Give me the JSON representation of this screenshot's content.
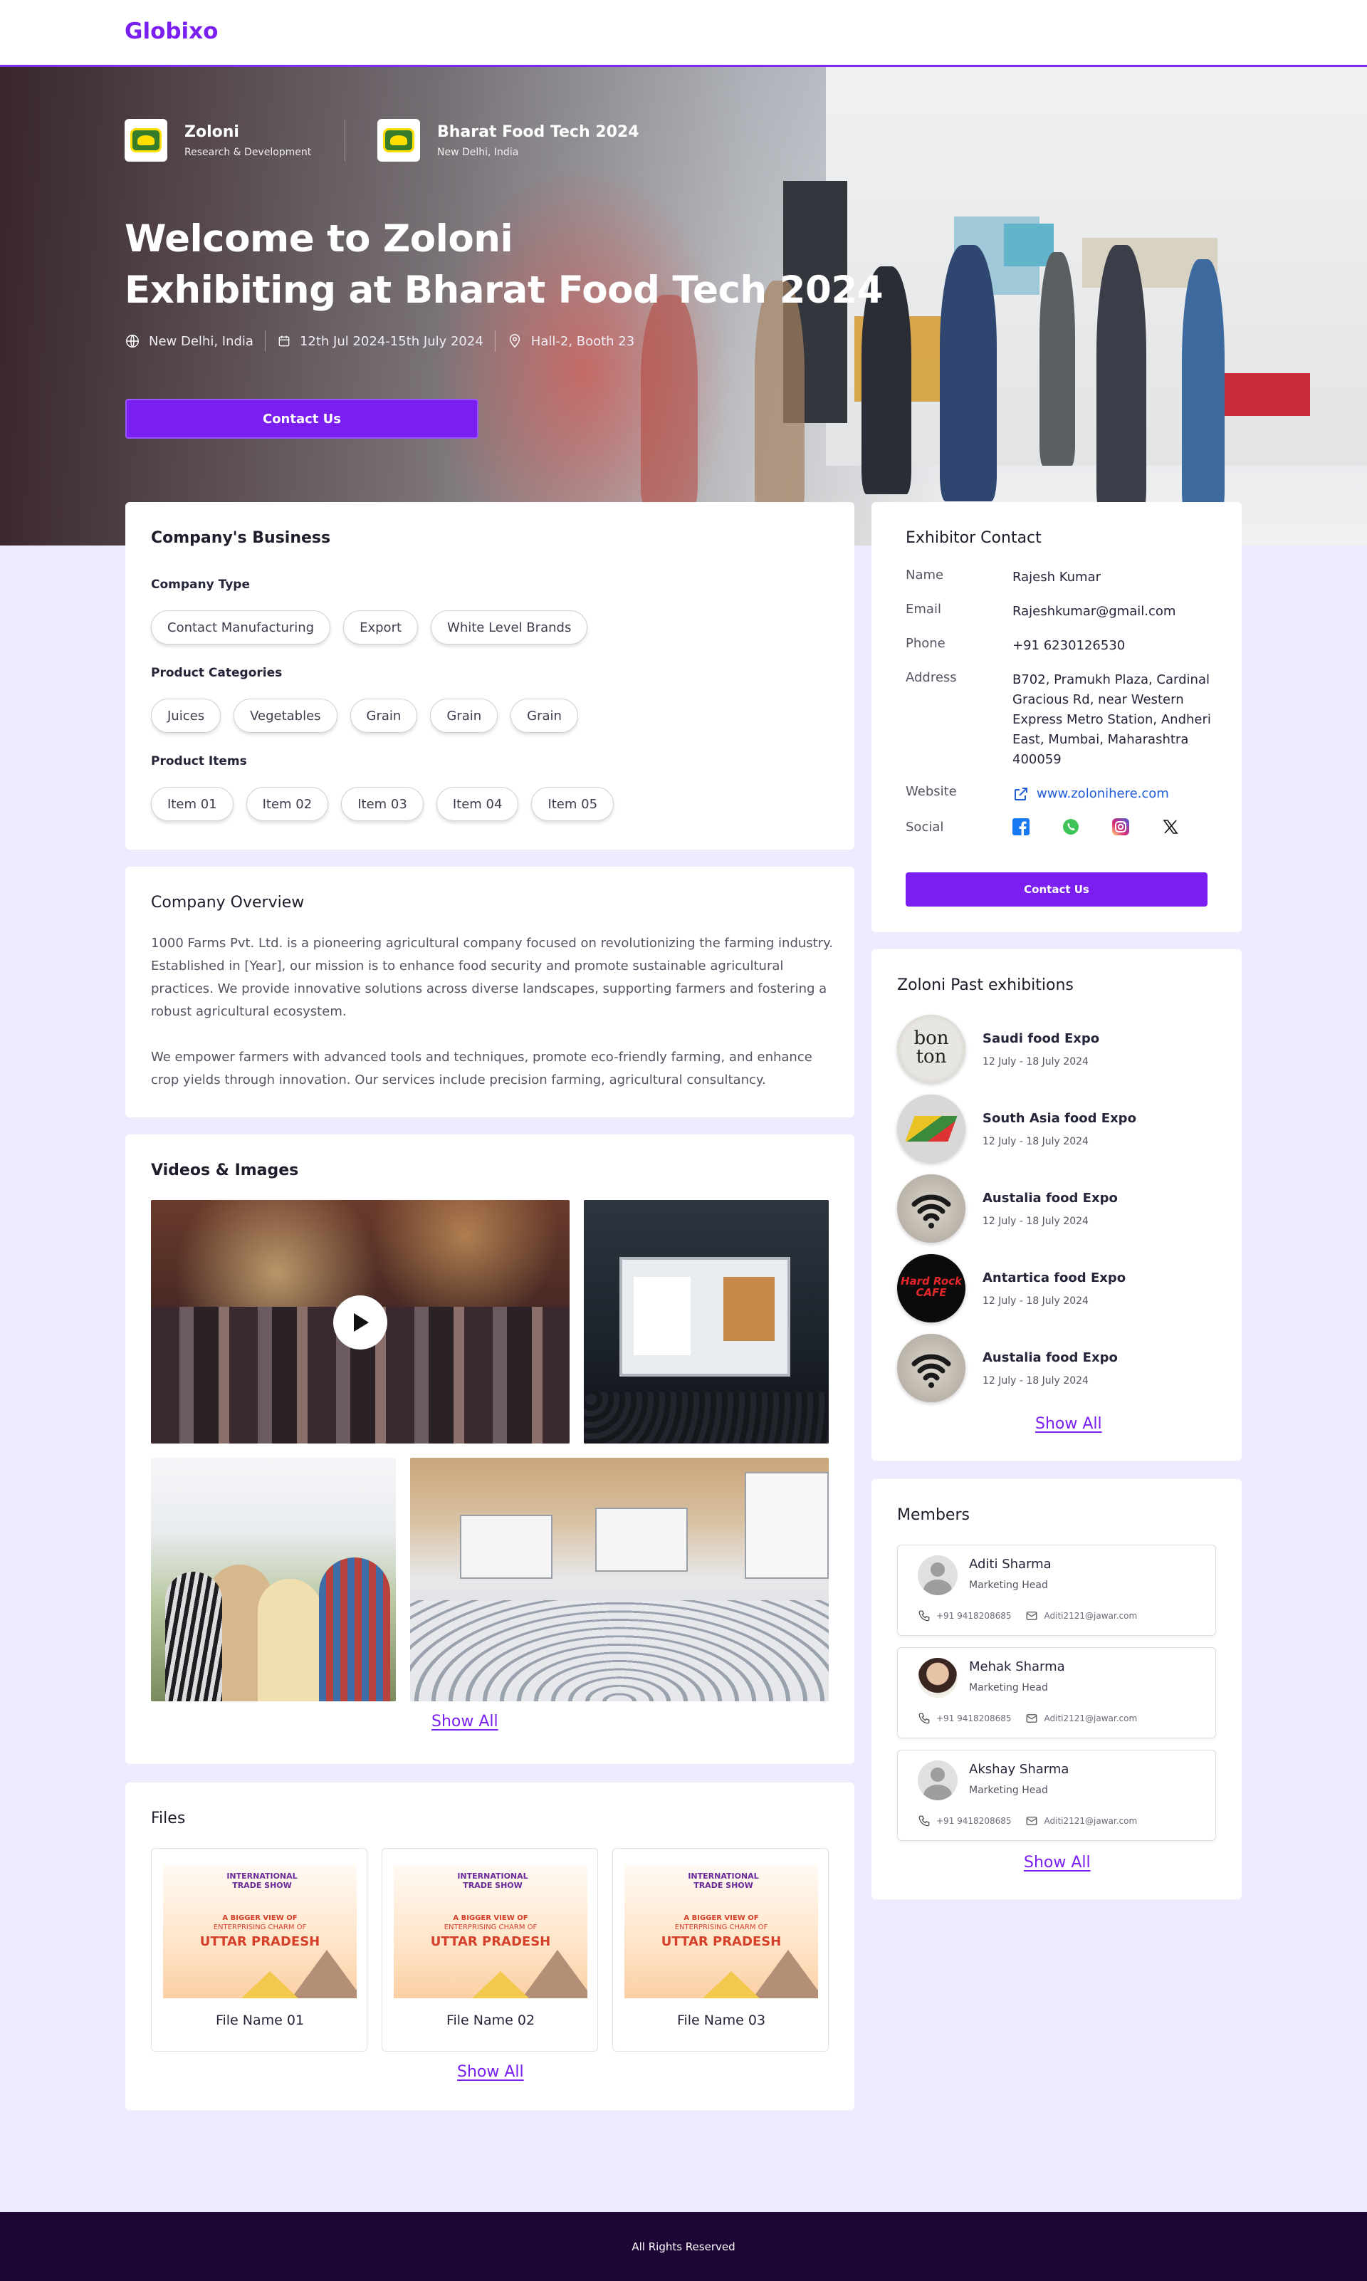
{
  "brand": {
    "name": "Globixo"
  },
  "hero": {
    "company": {
      "name": "Zoloni",
      "sub": "Research & Development"
    },
    "event": {
      "name": "Bharat Food Tech  2024",
      "sub": "New Delhi, India"
    },
    "title_line1": "Welcome to Zoloni",
    "title_line2": "Exhibiting at Bharat Food Tech  2024",
    "location": "New Delhi, India",
    "dates": "12th Jul 2024-15th July 2024",
    "booth": "Hall-2, Booth 23",
    "cta": "Contact Us"
  },
  "business": {
    "title": "Company's Business",
    "company_type_label": "Company Type",
    "company_types": [
      "Contact Manufacturing",
      "Export",
      "White Level Brands"
    ],
    "product_categories_label": "Product Categories",
    "product_categories": [
      "Juices",
      "Vegetables",
      "Grain",
      "Grain",
      "Grain"
    ],
    "product_items_label": "Product Items",
    "product_items": [
      "Item 01",
      "Item 02",
      "Item 03",
      "Item 04",
      "Item 05"
    ]
  },
  "overview": {
    "title": "Company Overview",
    "p1": "1000 Farms Pvt. Ltd. is a pioneering agricultural company focused on revolutionizing the farming industry. Established in [Year], our mission is to enhance food security and promote sustainable agricultural practices. We provide innovative solutions across diverse landscapes, supporting farmers and fostering a robust agricultural ecosystem.",
    "p2": "We empower farmers with advanced tools and techniques, promote eco-friendly farming, and enhance crop yields through innovation. Our services include precision farming, agricultural consultancy."
  },
  "media": {
    "title": "Videos & Images",
    "show_all": "Show All"
  },
  "files": {
    "title": "Files",
    "items": [
      {
        "name": "File Name 01"
      },
      {
        "name": "File Name 02"
      },
      {
        "name": "File Name 03"
      }
    ],
    "thumb_heading": "INTERNATIONAL TRADE SHOW",
    "thumb_line1": "A BIGGER VIEW OF",
    "thumb_line2": "ENTERPRISING CHARM OF",
    "thumb_line3": "UTTAR PRADESH",
    "show_all": "Show All"
  },
  "contact": {
    "title": "Exhibitor Contact",
    "name_label": "Name",
    "name": "Rajesh Kumar",
    "email_label": "Email",
    "email": "Rajeshkumar@gmail.com",
    "phone_label": "Phone",
    "phone": "+91 6230126530",
    "address_label": "Address",
    "address": "B702, Pramukh Plaza, Cardinal Gracious Rd, near Western Express Metro Station, Andheri East, Mumbai, Maharashtra 400059",
    "website_label": "Website",
    "website": "www.zolonihere.com",
    "social_label": "Social",
    "social_icons": [
      "facebook-icon",
      "whatsapp-icon",
      "instagram-icon",
      "x-icon"
    ],
    "button": "Contact Us"
  },
  "exhibitions": {
    "title": "Zoloni Past exhibitions",
    "items": [
      {
        "name": "Saudi food Expo",
        "date": "12 July - 18 July 2024",
        "logo_text": "bon ton"
      },
      {
        "name": "South Asia food Expo",
        "date": "12 July - 18 July 2024"
      },
      {
        "name": "Austalia food Expo",
        "date": "12 July - 18 July 2024"
      },
      {
        "name": "Antartica food Expo",
        "date": "12 July - 18 July 2024",
        "logo_text": "Hard Rock CAFE"
      },
      {
        "name": "Austalia food Expo",
        "date": "12 July - 18 July 2024"
      }
    ],
    "show_all": "Show All"
  },
  "members": {
    "title": "Members",
    "items": [
      {
        "name": "Aditi Sharma",
        "role": "Marketing Head",
        "phone": "+91 9418208685",
        "email": "Aditi2121@jawar.com"
      },
      {
        "name": "Mehak Sharma",
        "role": "Marketing Head",
        "phone": "+91 9418208685",
        "email": "Aditi2121@jawar.com"
      },
      {
        "name": "Akshay Sharma",
        "role": "Marketing Head",
        "phone": "+91 9418208685",
        "email": "Aditi2121@jawar.com"
      }
    ],
    "show_all": "Show All"
  },
  "footer": {
    "text": "All Rights Reserved"
  },
  "colors": {
    "accent": "#7a1ff0",
    "page_bg": "#eceafd",
    "footer_bg": "#1d0535"
  }
}
